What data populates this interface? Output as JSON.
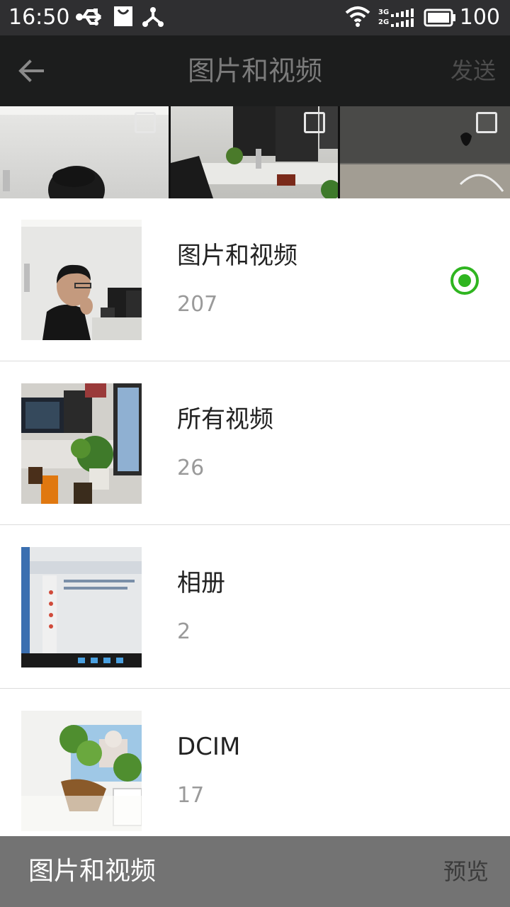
{
  "status_bar": {
    "time": "16:50",
    "icons": [
      "usb-icon",
      "shopping-bag-icon",
      "share-node-icon",
      "wifi-icon",
      "signal-3g-2g-icon",
      "battery-icon"
    ],
    "network_labels": [
      "3G",
      "2G"
    ],
    "battery_percent": "100"
  },
  "header": {
    "back_icon": "arrow-left-icon",
    "title": "图片和视频",
    "send_label": "发送"
  },
  "albums": [
    {
      "name": "图片和视频",
      "count": "207",
      "selected": true
    },
    {
      "name": "所有视频",
      "count": "26",
      "selected": false
    },
    {
      "name": "相册",
      "count": "2",
      "selected": false
    },
    {
      "name": "DCIM",
      "count": "17",
      "selected": false
    }
  ],
  "bottom_bar": {
    "current_album": "图片和视频",
    "preview_label": "预览"
  },
  "colors": {
    "accent_green": "#2fb520",
    "header_bg": "#1c1d1d",
    "statusbar_bg": "#2f2f31",
    "bottom_bar_bg": "#737373"
  }
}
